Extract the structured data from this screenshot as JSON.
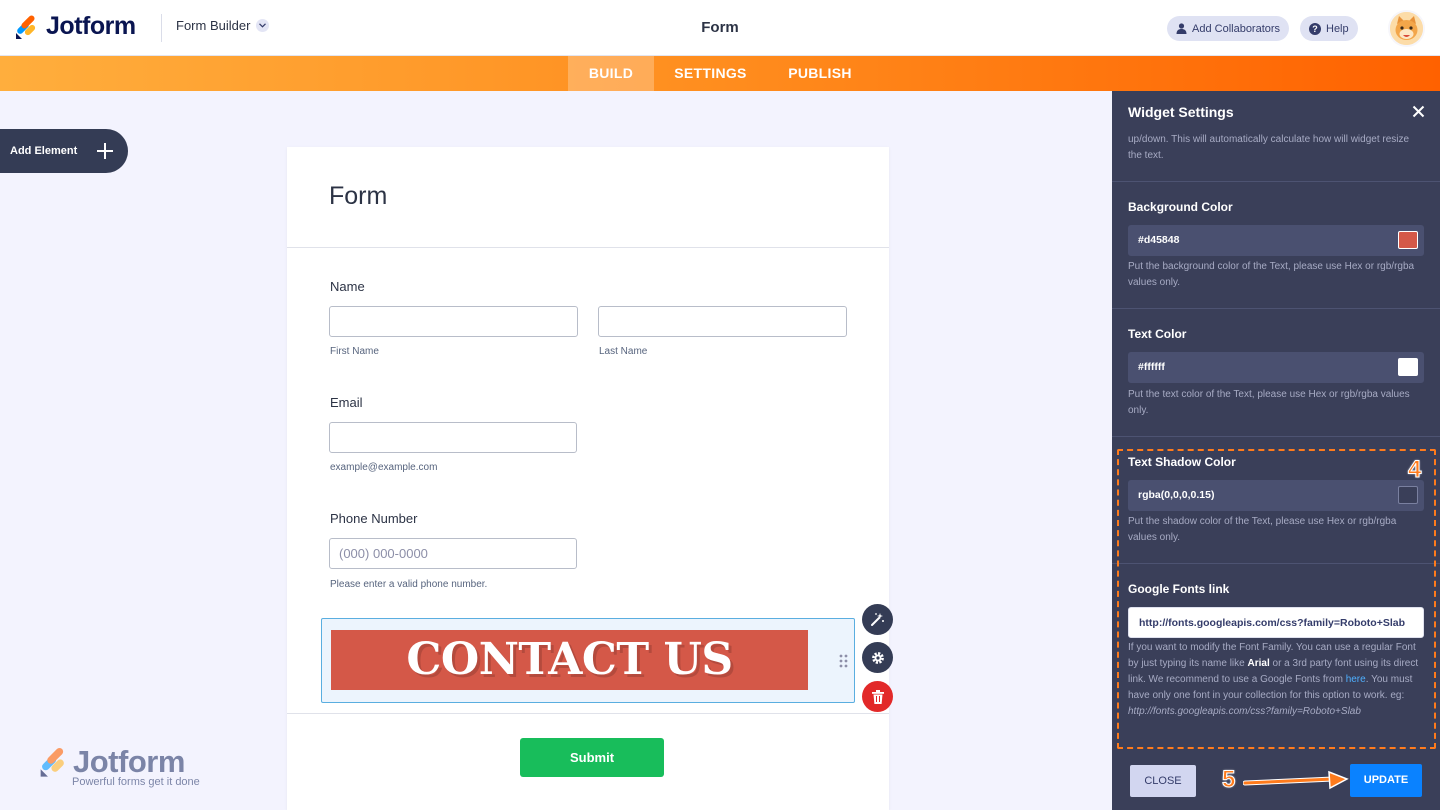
{
  "header": {
    "brand": "Jotform",
    "form_builder_label": "Form Builder",
    "title": "Form",
    "add_collaborators": "Add Collaborators",
    "help": "Help"
  },
  "nav": {
    "tabs": [
      {
        "label": "BUILD",
        "active": true
      },
      {
        "label": "SETTINGS",
        "active": false
      },
      {
        "label": "PUBLISH",
        "active": false
      }
    ]
  },
  "add_element": {
    "label": "Add Element"
  },
  "form": {
    "title": "Form",
    "name": {
      "label": "Name",
      "first_sub": "First Name",
      "last_sub": "Last Name"
    },
    "email": {
      "label": "Email",
      "sub": "example@example.com"
    },
    "phone": {
      "label": "Phone Number",
      "placeholder": "(000) 000-0000",
      "sub": "Please enter a valid phone number."
    },
    "banner_text": "CONTACT US",
    "submit": "Submit"
  },
  "watermark": {
    "brand": "Jotform",
    "tagline": "Powerful forms get it done"
  },
  "panel": {
    "title": "Widget Settings",
    "top_text": "up/down. This will automatically calculate how will widget resize the text.",
    "background_color": {
      "label": "Background Color",
      "value": "#d45848",
      "help": "Put the background color of the Text, please use Hex or rgb/rgba values only."
    },
    "text_color": {
      "label": "Text Color",
      "value": "#ffffff",
      "help": "Put the text color of the Text, please use Hex or rgb/rgba values only."
    },
    "text_shadow_color": {
      "label": "Text Shadow Color",
      "value": "rgba(0,0,0,0.15)",
      "help": "Put the shadow color of the Text, please use Hex or rgb/rgba values only."
    },
    "google_fonts": {
      "label": "Google Fonts link",
      "value": "http://fonts.googleapis.com/css?family=Roboto+Slab",
      "help_1": "If you want to modify the Font Family. You can use a regular Font by just typing its name like ",
      "help_bold": "Arial",
      "help_2": " or a 3rd party font using its direct link. We recommend to use a Google Fonts from ",
      "help_link": "here",
      "help_3": ". You must have only one font in your collection for this option to work. eg: ",
      "help_example": "http://fonts.googleapis.com/css?family=Roboto+Slab"
    },
    "close_button": "CLOSE",
    "update_button": "UPDATE"
  },
  "annotations": {
    "step4": "4",
    "step5": "5"
  },
  "colors": {
    "accent_orange": "#ff7b1c",
    "panel_bg": "#3a3f59",
    "submit_green": "#18bd5b",
    "update_blue": "#0a82ff",
    "banner_bg": "#d45848",
    "delete_red": "#e22929"
  },
  "icons": [
    "jotform-logo-icon",
    "chevron-down-icon",
    "user-icon",
    "help-icon",
    "avatar",
    "plus-icon",
    "magic-wand-icon",
    "gear-icon",
    "trash-icon",
    "drag-handle-icon",
    "close-icon",
    "arrow-right-icon"
  ]
}
